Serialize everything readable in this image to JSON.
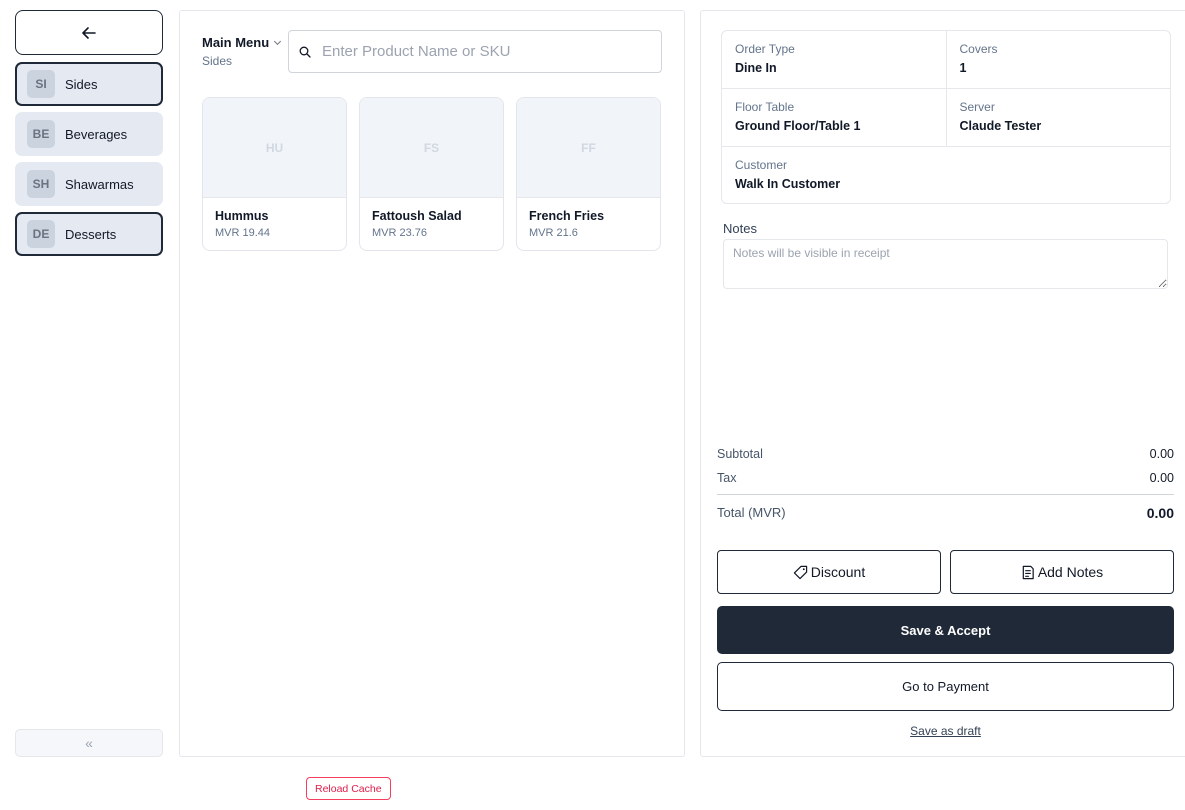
{
  "sidebar": {
    "back_icon": "arrow-left-icon",
    "categories": [
      {
        "badge": "SI",
        "label": "Sides",
        "active": true
      },
      {
        "badge": "BE",
        "label": "Beverages",
        "active": false
      },
      {
        "badge": "SH",
        "label": "Shawarmas",
        "active": false
      },
      {
        "badge": "DE",
        "label": "Desserts",
        "active": true
      }
    ],
    "collapse_label": "«"
  },
  "products_panel": {
    "menu_name": "Main Menu",
    "current_category": "Sides",
    "search_placeholder": "Enter Product Name or SKU",
    "search_value": "",
    "items": [
      {
        "initials": "HU",
        "name": "Hummus",
        "price": "MVR 19.44"
      },
      {
        "initials": "FS",
        "name": "Fattoush Salad",
        "price": "MVR 23.76"
      },
      {
        "initials": "FF",
        "name": "French Fries",
        "price": "MVR 21.6"
      }
    ]
  },
  "reload_label": "Reload Cache",
  "order": {
    "order_type_label": "Order Type",
    "order_type": "Dine In",
    "covers_label": "Covers",
    "covers": "1",
    "floor_table_label": "Floor Table",
    "floor_table": "Ground Floor/Table 1",
    "server_label": "Server",
    "server": "Claude Tester",
    "customer_label": "Customer",
    "customer": "Walk In Customer",
    "notes_label": "Notes",
    "notes_placeholder": "Notes will be visible in receipt",
    "subtotal_label": "Subtotal",
    "subtotal": "0.00",
    "tax_label": "Tax",
    "tax": "0.00",
    "total_label": "Total (MVR)",
    "total": "0.00",
    "discount_label": "Discount",
    "add_notes_label": "Add Notes",
    "save_accept_label": "Save & Accept",
    "payment_label": "Go to Payment",
    "draft_label": "Save as draft"
  },
  "colors": {
    "primary_dark": "#1f2937",
    "accent_red": "#e11d48",
    "category_bg": "#e5e9f1"
  }
}
